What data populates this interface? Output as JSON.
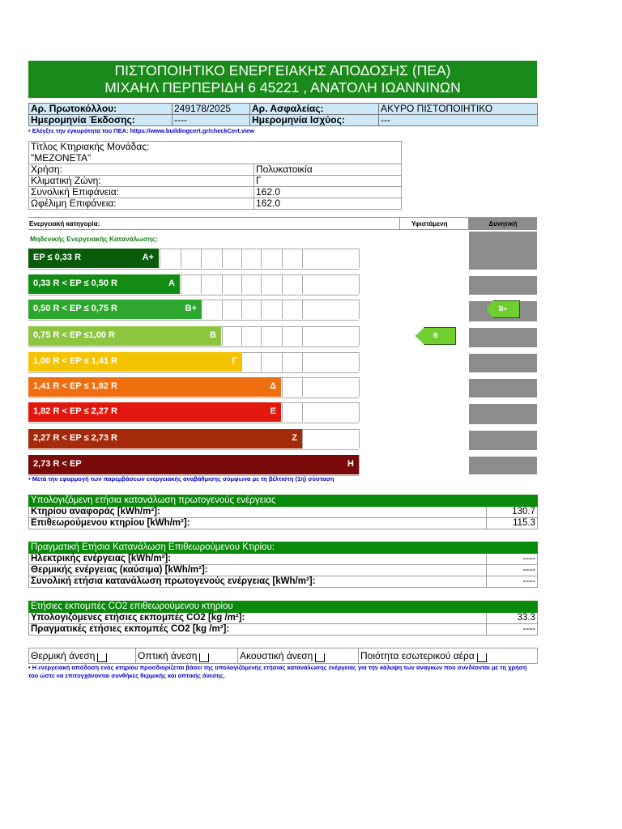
{
  "header": {
    "title_line1": "ΠΙΣΤΟΠΟΙΗΤΙΚΟ ΕΝΕΡΓΕΙΑΚΗΣ ΑΠΟΔΟΣΗΣ (ΠΕΑ)",
    "title_line2": "ΜΙΧΑΗΛ ΠΕΡΠΕΡΙΔΗ 6 45221 , ΑΝΑΤΟΛΗ ΙΩΑΝΝΙΝΩΝ"
  },
  "info": {
    "protocol_label": "Αρ. Πρωτοκόλλου:",
    "protocol_value": "249178/2025",
    "insurance_label": "Αρ. Ασφαλείας:",
    "insurance_value": "ΑΚΥΡΟ ΠΙΣΤΟΠΟΙΗΤΙΚΟ",
    "issue_label": "Ημερομηνία Έκδοσης:",
    "issue_value": "----",
    "valid_label": "Ημερομηνία Ισχύος:",
    "valid_value": "---",
    "check_note": "• Ελέγξτε την εγκυρότητα του ΠΕΑ: https://www.buildingcert.gr/checkCert.view"
  },
  "unit": {
    "title_label": "Τίτλος Κτηριακής Μονάδας:",
    "title_value": "\"ΜΕΖΟΝΕΤΑ\"",
    "use_label": "Χρήση:",
    "use_value": "Πολυκατοικία",
    "zone_label": "Κλιματική Ζώνη:",
    "zone_value": "Γ",
    "total_area_label": "Συνολική Επιφάνεια:",
    "total_area_value": "162.0",
    "useful_area_label": "Ωφέλιμη Επιφάνεια:",
    "useful_area_value": "162.0"
  },
  "scale": {
    "category_label": "Ενεργειακή κατηγορία:",
    "existing_label": "Υφιστάμενη",
    "potential_label": "Δυνητική",
    "zero_label": "Μηδενικής Ενεργειακής Κατανάλωσης:",
    "bands": [
      {
        "range": "EP ≤ 0,33 R",
        "cls": "A+",
        "color": "#0a5c0a"
      },
      {
        "range": "0,33 R < EP ≤ 0,50 R",
        "cls": "A",
        "color": "#138c13"
      },
      {
        "range": "0,50 R < EP ≤ 0,75 R",
        "cls": "B+",
        "color": "#2ea72e"
      },
      {
        "range": "0,75 R < EP ≤1,00 R",
        "cls": "B",
        "color": "#8cc63e"
      },
      {
        "range": "1,00 R < EP ≤ 1,41 R",
        "cls": "Γ",
        "color": "#f5c400"
      },
      {
        "range": "1,41 R < EP ≤ 1,82 R",
        "cls": "Δ",
        "color": "#ef6e10"
      },
      {
        "range": "1,82 R < EP ≤ 2,27 R",
        "cls": "Ε",
        "color": "#e3170d"
      },
      {
        "range": "2,27 R <  EP ≤  2,73 R",
        "cls": "Ζ",
        "color": "#a52a0a"
      },
      {
        "range": "2,73 R < EP",
        "cls": "Η",
        "color": "#7a0a0a"
      }
    ],
    "existing_class": "B",
    "potential_class": "B+",
    "measures_note": "• Μετά την εφαρμογή των παρεμβάσεων ενεργειακής αναβάθμισης σύμφωνα με τη βέλτιστη (1η) σύσταση"
  },
  "calc": {
    "title": "Υπολογιζόμενη ετήσια κατανάλωση πρωτογενούς ενέργειας",
    "ref_label": "Κτηρίου αναφοράς [kWh/m²]:",
    "ref_value": "130.7",
    "insp_label": "Επιθεωρούμενου κτηρίου [kWh/m²]:",
    "insp_value": "115.3"
  },
  "actual": {
    "title": "Πραγματική Ετήσια Κατανάλωση Επιθεωρούμενου Κτιρίου:",
    "elec_label": "Ηλεκτρικής ενέργειας [kWh/m²]:",
    "elec_value": "----",
    "thermal_label": "Θερμικής ενέργειας (καύσιμα) [kWh/m²]:",
    "thermal_value": "----",
    "total_label": "Συνολική ετήσια κατανάλωση πρωτογενούς ενέργειας [kWh/m²]:",
    "total_value": "----"
  },
  "co2": {
    "title": "Ετήσιες εκπομπές CO2 επιθεωρούμενου κτηρίου",
    "calc_label": "Υπολογιζόμενες ετήσιες εκπομπές CO2 [kg /m²]:",
    "calc_value": "33.3",
    "real_label": "Πραγματικές ετήσιες εκπομπές CO2 [kg /m²]:",
    "real_value": "----"
  },
  "comfort": {
    "thermal": "Θερμική άνεση",
    "optical": "Οπτική άνεση",
    "acoustic": "Ακουστική άνεση",
    "air": "Ποιότητα εσωτερικού αέρα"
  },
  "footer_note": "• Η ενεργειακή απόδοση ενός κτηρίου προσδιορίζεται βάσει της υπολογιζόμενης ετήσιας κατανάλωσης ενέργειας για την κάλυψη των αναγκών που συνδέονται με τη χρήση του ώστε να επιτυγχάνονται συνθήκες θερμικής και οπτικής άνεσης."
}
